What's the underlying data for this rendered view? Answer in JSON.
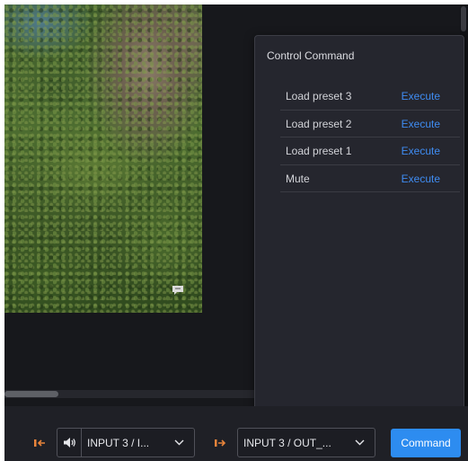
{
  "popover": {
    "title": "Control Command",
    "commands": [
      {
        "label": "Load preset 3",
        "action": "Execute"
      },
      {
        "label": "Load preset 2",
        "action": "Execute"
      },
      {
        "label": "Load preset 1",
        "action": "Execute"
      },
      {
        "label": "Mute",
        "action": "Execute"
      }
    ]
  },
  "toolbar": {
    "input_select_value": "INPUT 3 / I...",
    "output_select_value": "INPUT 3 / OUT_...",
    "command_button_label": "Command"
  },
  "icons": {
    "input_arrow": "arrow-left-icon",
    "volume": "volume-icon",
    "output_arrow": "arrow-right-icon",
    "chevron": "chevron-down-icon",
    "comment": "comment-icon"
  },
  "colors": {
    "accent": "#2d8cf0",
    "link": "#3f8cf2",
    "arrow_orange": "#e8843a",
    "panel_bg": "#25262e",
    "app_bg": "#1c1d22"
  }
}
